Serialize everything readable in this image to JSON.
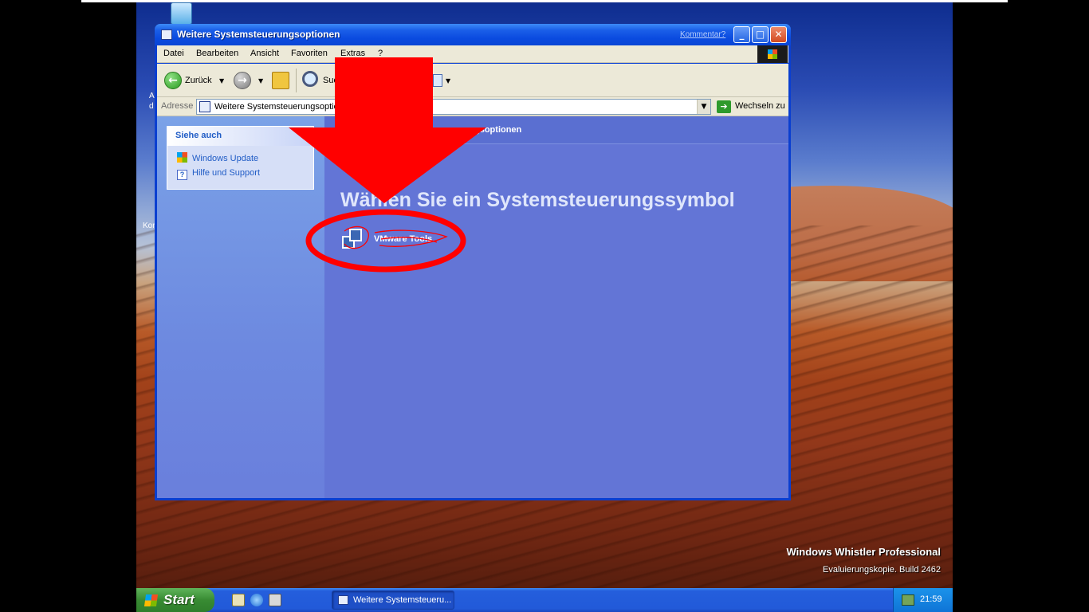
{
  "window": {
    "title": "Weitere Systemsteuerungsoptionen",
    "feedback_link": "Kommentar?",
    "min_glyph": "_",
    "max_glyph": "□",
    "close_glyph": "✕"
  },
  "menu": {
    "items": [
      "Datei",
      "Bearbeiten",
      "Ansicht",
      "Favoriten",
      "Extras",
      "?"
    ]
  },
  "toolbar": {
    "back_label": "Zurück",
    "search_label": "Suc"
  },
  "address": {
    "label": "Adresse",
    "value": "Weitere Systemsteuerungsoptio",
    "go_label": "Wechseln zu"
  },
  "taskpane": {
    "see_also_title": "Siehe auch",
    "links": [
      "Windows Update",
      "Hilfe und Support"
    ]
  },
  "main": {
    "header": "gsoptionen",
    "title": "Wählen Sie ein Systemsteuerungssymbol",
    "items": [
      "VMware Tools"
    ]
  },
  "desktop": {
    "watermark_line1": "Windows Whistler Professional",
    "watermark_line2": "Evaluierungskopie.  Build 2462",
    "edge_text_1": "A",
    "edge_text_2": "d",
    "edge_text_3": "Kor"
  },
  "taskbar": {
    "start_label": "Start",
    "task_label": "Weitere Systemsteueru...",
    "clock": "21:59"
  },
  "annotation": {
    "color": "#ff0000"
  }
}
